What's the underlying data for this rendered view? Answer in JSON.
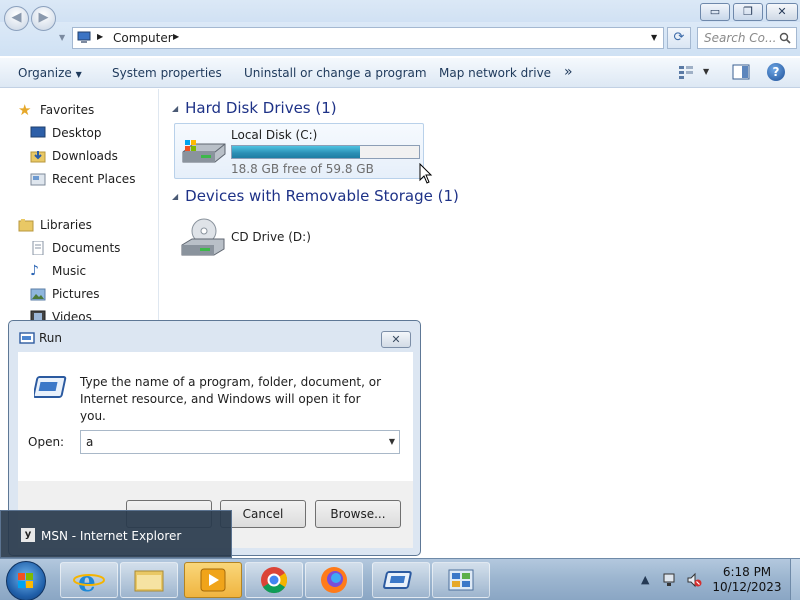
{
  "explorer": {
    "window_buttons": {
      "minimize": "▭",
      "restore": "❐",
      "close": "✕"
    },
    "address_path": "Computer",
    "search_placeholder": "Search Co...",
    "commands": [
      "Organize",
      "System properties",
      "Uninstall or change a program",
      "Map network drive",
      "»"
    ],
    "nav": {
      "favorites": "Favorites",
      "favorite_items": [
        "Desktop",
        "Downloads",
        "Recent Places"
      ],
      "libraries": "Libraries",
      "library_items": [
        "Documents",
        "Music",
        "Pictures",
        "Videos"
      ]
    },
    "hard_disk_header": "Hard Disk Drives (1)",
    "local_disk": {
      "name": "Local Disk (C:)",
      "space": "18.8 GB free of 59.8 GB",
      "used_fraction": 0.686
    },
    "removable_header": "Devices with Removable Storage (1)",
    "cd_drive": {
      "name": "CD Drive (D:)"
    }
  },
  "run": {
    "title": "Run",
    "close": "✕",
    "description": "Type the name of a program, folder, document, or Internet resource, and Windows will open it for you.",
    "open_label": "Open:",
    "input_value": "a",
    "cancel": "Cancel",
    "browse": "Browse..."
  },
  "tooltip": {
    "text": "MSN - Internet Explorer"
  },
  "taskbar": {
    "time": "6:18 PM",
    "date": "10/12/2023",
    "apps": [
      "internet-explorer-icon",
      "file-explorer-icon",
      "media-player-icon",
      "chrome-icon",
      "firefox-icon",
      "run-app-icon",
      "control-panel-icon"
    ]
  },
  "colors": {
    "header_blue": "#1e3287",
    "progress": "#2b8eb4",
    "taskbar": "#9db6d0"
  }
}
